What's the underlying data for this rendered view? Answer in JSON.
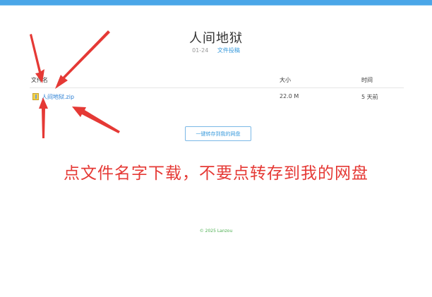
{
  "page": {
    "title": "人间地狱",
    "date": "01-24",
    "category": "文件投稿"
  },
  "table": {
    "headers": {
      "name": "文件名",
      "size": "大小",
      "time": "时间"
    },
    "rows": [
      {
        "name": "人间地狱.zip",
        "size": "22.0 M",
        "time": "5 天前"
      }
    ]
  },
  "actions": {
    "save_label": "一键转存到我的网盘"
  },
  "notice": {
    "text": "点文件名字下载，不要点转存到我的网盘",
    "color": "#e53935"
  },
  "footer": {
    "text": "© 2025 Lanzou"
  },
  "colors": {
    "accent": "#3a9bdc",
    "top_bar": "#4aa6e8",
    "annotation": "#e53935"
  }
}
